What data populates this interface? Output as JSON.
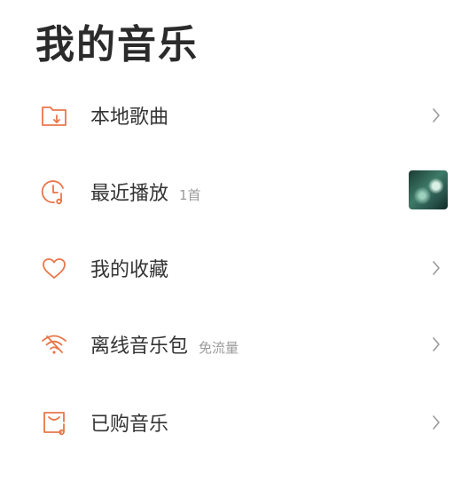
{
  "page": {
    "title": "我的音乐"
  },
  "accent_color": "#e8774a",
  "items": [
    {
      "label": "本地歌曲",
      "sub": "",
      "icon": "folder-download-icon",
      "trailing": "chevron"
    },
    {
      "label": "最近播放",
      "sub": "1首",
      "icon": "clock-music-icon",
      "trailing": "album-thumbnail"
    },
    {
      "label": "我的收藏",
      "sub": "",
      "icon": "heart-icon",
      "trailing": "chevron"
    },
    {
      "label": "离线音乐包",
      "sub": "免流量",
      "icon": "wifi-icon",
      "trailing": "chevron"
    },
    {
      "label": "已购音乐",
      "sub": "",
      "icon": "purchased-music-icon",
      "trailing": "chevron"
    }
  ]
}
